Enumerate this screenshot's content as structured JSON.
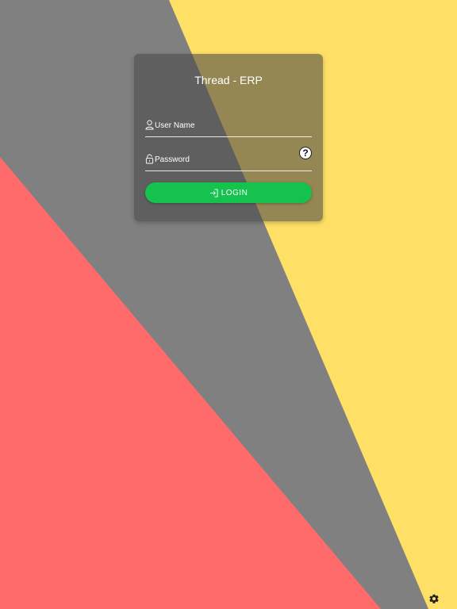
{
  "app": {
    "title": "Thread - ERP"
  },
  "login_form": {
    "username": {
      "placeholder": "User Name",
      "value": "",
      "icon": "user-icon"
    },
    "password": {
      "placeholder": "Password",
      "value": "",
      "icon": "lock-icon",
      "help_label": "?"
    },
    "login_button": {
      "label": "LOGIN",
      "icon": "login-icon"
    }
  },
  "footer": {
    "settings_icon": "gear-icon"
  },
  "colors": {
    "background_gray": "#808080",
    "background_yellow": "#ffe066",
    "background_red": "#ff6b6b",
    "accent_green": "#16c24e",
    "text": "#ffffff"
  }
}
